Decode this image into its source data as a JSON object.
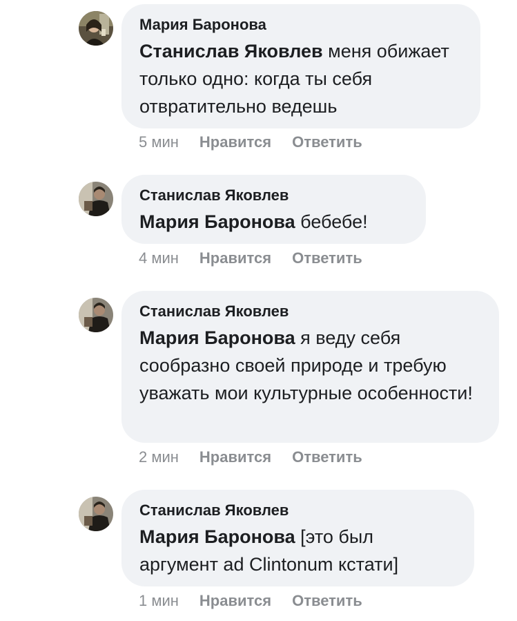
{
  "comments": [
    {
      "author": "Мария Баронова",
      "mention": "Станислав Яковлев",
      "text": " меня обижает только одно: когда ты себя отвратительно ведешь",
      "time": "5 мин",
      "like_label": "Нравится",
      "reply_label": "Ответить",
      "avatar_icon": "avatar-woman-selfie"
    },
    {
      "author": "Станислав Яковлев",
      "mention": "Мария Баронова",
      "text": " бебебе!",
      "time": "4 мин",
      "like_label": "Нравится",
      "reply_label": "Ответить",
      "avatar_icon": "avatar-man"
    },
    {
      "author": "Станислав Яковлев",
      "mention": "Мария Баронова",
      "text": " я веду себя сообразно своей природе и требую уважать мои культурные особенности!",
      "time": "2 мин",
      "like_label": "Нравится",
      "reply_label": "Ответить",
      "avatar_icon": "avatar-man"
    },
    {
      "author": "Станислав Яковлев",
      "mention": "Мария Баронова",
      "text": " [это был аргумент ad Clintonum кстати]",
      "time": "1 мин",
      "like_label": "Нравится",
      "reply_label": "Ответить",
      "avatar_icon": "avatar-man"
    }
  ],
  "colors": {
    "bubble": "#f0f2f5",
    "meta": "#8a8d91",
    "text": "#1c1e21"
  }
}
